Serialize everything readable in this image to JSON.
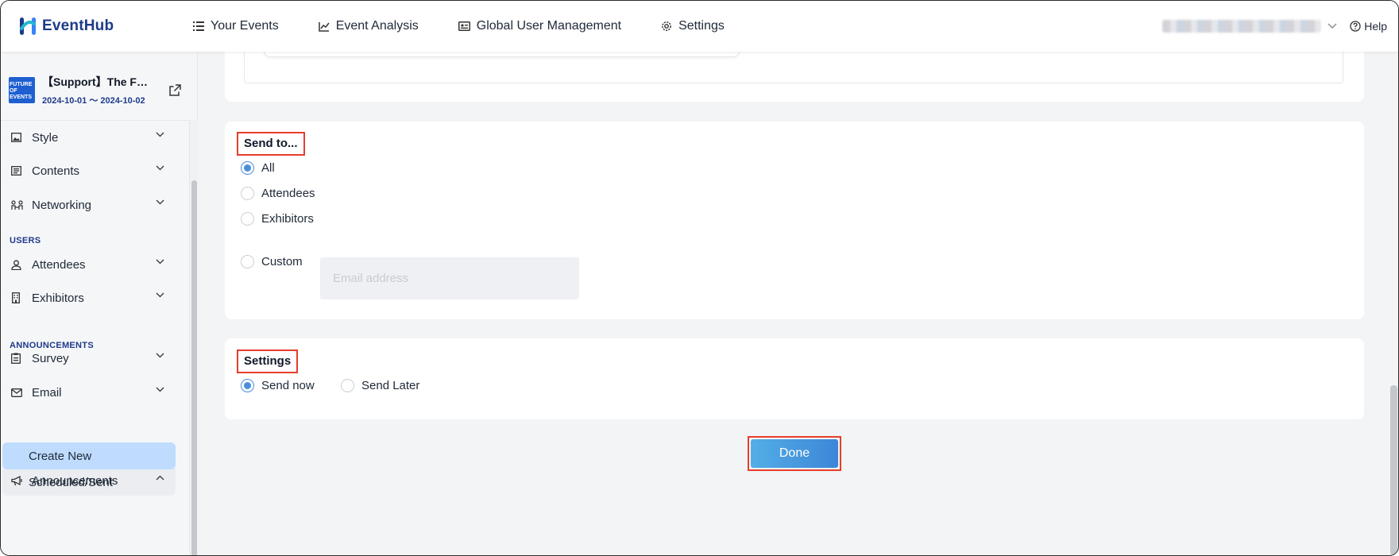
{
  "app": {
    "name": "EventHub",
    "brand_color": "#1e3a8a"
  },
  "nav": {
    "items": [
      {
        "label": "Your Events",
        "icon": "list-icon"
      },
      {
        "label": "Event Analysis",
        "icon": "chart-icon"
      },
      {
        "label": "Global User Management",
        "icon": "id-card-icon"
      },
      {
        "label": "Settings",
        "icon": "gear-icon"
      }
    ],
    "help": "Help"
  },
  "event": {
    "title": "【Support】The F…",
    "dates": "2024-10-01 〜 2024-10-02",
    "thumb_text": "FUTURE OF EVENTS"
  },
  "sidebar": {
    "items": [
      {
        "label": "Style",
        "icon": "image-icon"
      },
      {
        "label": "Contents",
        "icon": "document-icon"
      },
      {
        "label": "Networking",
        "icon": "networking-icon"
      }
    ],
    "users_label": "USERS",
    "user_items": [
      {
        "label": "Attendees",
        "icon": "person-icon"
      },
      {
        "label": "Exhibitors",
        "icon": "building-icon"
      }
    ],
    "announcements_label": "ANNOUNCEMENTS",
    "announcement_items": [
      {
        "label": "Survey",
        "icon": "clipboard-icon"
      },
      {
        "label": "Email",
        "icon": "mail-icon"
      },
      {
        "label": "Announcements",
        "icon": "megaphone-icon"
      }
    ],
    "sub_items": [
      {
        "label": "Create New",
        "active": true
      },
      {
        "label": "Scheduled/Sent",
        "active": false
      }
    ]
  },
  "send_to": {
    "title": "Send to...",
    "options": [
      "All",
      "Attendees",
      "Exhibitors",
      "Custom"
    ],
    "selected": "All",
    "email_placeholder": "Email address"
  },
  "settings": {
    "title": "Settings",
    "options": [
      "Send now",
      "Send Later"
    ],
    "selected": "Send now"
  },
  "done_label": "Done",
  "colors": {
    "highlight_border": "#e53e2a",
    "radio_checked": "#4a8fdc",
    "active_sub_bg": "#bfdcff"
  }
}
